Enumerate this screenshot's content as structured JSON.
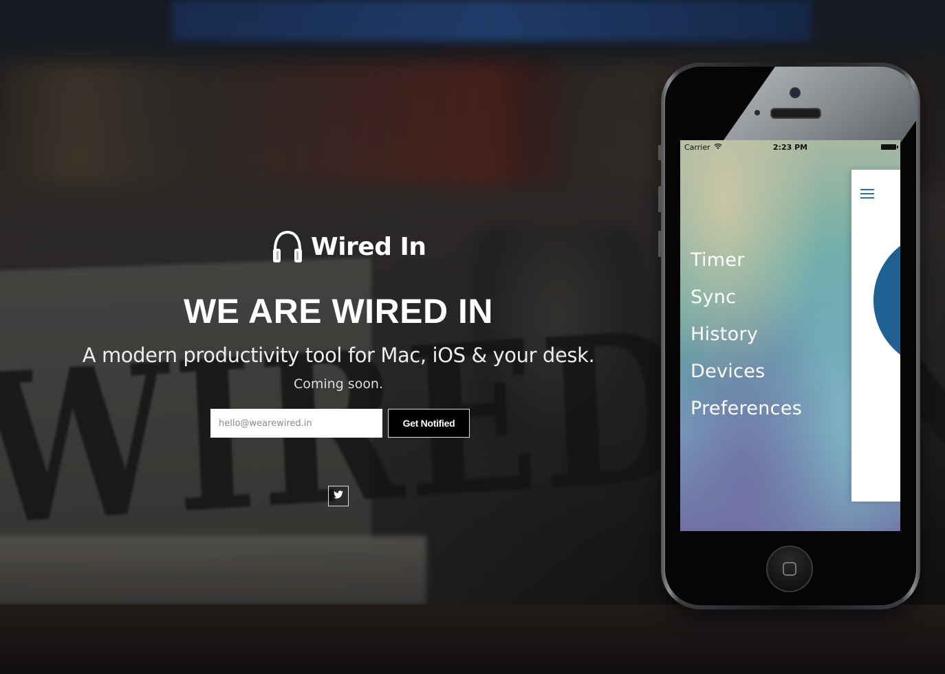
{
  "brand": {
    "name": "Wired In",
    "icon": "headphones-icon"
  },
  "hero": {
    "headline": "WE ARE WIRED IN",
    "tagline": "A modern productivity tool for Mac, iOS & your desk.",
    "subline": "Coming soon."
  },
  "signup": {
    "email_placeholder": "hello@wearewired.in",
    "button_label": "Get Notified"
  },
  "social": {
    "twitter_icon": "twitter-icon"
  },
  "background": {
    "sign_text": "WIRED IN"
  },
  "phone": {
    "status_bar": {
      "carrier": "Carrier",
      "time": "2:23 PM"
    },
    "menu_items": [
      "Timer",
      "Sync",
      "History",
      "Devices",
      "Preferences"
    ]
  },
  "colors": {
    "accent_blue": "#1f6193",
    "button_bg": "#000000",
    "text": "#ffffff"
  }
}
